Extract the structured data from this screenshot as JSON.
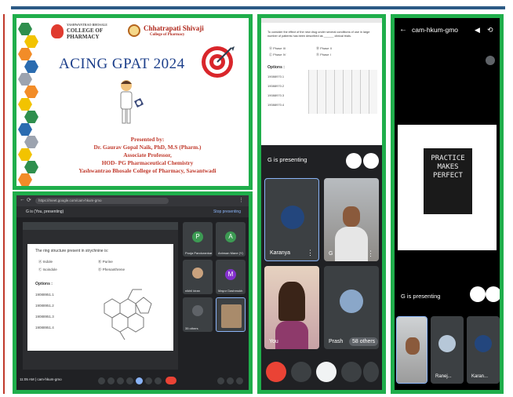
{
  "slide_title": {
    "college_name_small": "YASHWANTRAO BHOSALE",
    "college_name": "COLLEGE OF",
    "college_name2": "PHARMACY",
    "partner_name": "Chhatrapati Shivaji",
    "partner_sub": "College of Pharmacy",
    "title": "ACING GPAT 2024",
    "presented_by": "Presented by:",
    "presenter": "Dr. Gaurav Gopal Naik, PhD, M.S (Pharm.)",
    "role1": "Associate Professor,",
    "role2": "HOD- PG Pharmaceutical Chemistry",
    "institution": "Yashwantrao Bhosale College of Pharmacy, Sawantwadi"
  },
  "share_screen": {
    "url": "https://meet.google.com/cam-hkum-gmo",
    "presenting_label": "G is (You, presenting)",
    "stop_label": "Stop presenting",
    "question": "The ring structure present in strychnine is:",
    "options": [
      "Indole",
      "Purine",
      "Isoindole",
      "Phenanthrene"
    ],
    "options_heading": "Options :",
    "option_codes": [
      "19088951.1",
      "19088951.2",
      "19088951.3",
      "19088951.4"
    ],
    "tiles": [
      {
        "initial": "P",
        "name": "Pooja Pandurankar",
        "color": "#3c9a53"
      },
      {
        "initial": "A",
        "name": "Anirwan Mane (Y)",
        "color": "#3c9a53"
      },
      {
        "initial": "",
        "name": "nikhil kiran",
        "color": "#3c4043"
      },
      {
        "initial": "M",
        "name": "Mayur Dashmukh",
        "color": "#8430ce"
      },
      {
        "initial": "",
        "name": "35 others",
        "color": "#3c4043"
      },
      {
        "initial": "",
        "name": "",
        "color": "#3c4043"
      }
    ],
    "time_meeting": "11:05 AM  |  cam-hkum-gmo"
  },
  "phone1": {
    "question_text": "To consider the effect of the new drug under several conditions of use in large number of patients has been described as ______ clinical trials.",
    "options": [
      "Phase III",
      "Phase II",
      "Phase IV",
      "Phase I"
    ],
    "options_heading": "Options :",
    "option_codes": [
      "19088970.1",
      "19088970.2",
      "19088970.3",
      "19088970.4"
    ],
    "presenting": "G is presenting",
    "tiles": [
      {
        "name": "Karanya"
      },
      {
        "name": "G"
      },
      {
        "name": "You"
      },
      {
        "name": "Prash"
      }
    ],
    "others": "58 others"
  },
  "phone2": {
    "meeting_code": "cam-hkum-gmo",
    "slide_text_1": "PRACTICE",
    "slide_text_2": "MAKES",
    "slide_text_3": "PERFECT",
    "presenting": "G is presenting",
    "tiles": [
      {
        "name": ""
      },
      {
        "name": "Ranej..."
      },
      {
        "name": "Karan..."
      }
    ]
  },
  "colors": {
    "frame_green": "#1fae4b",
    "meet_dark": "#202124",
    "end_call_red": "#ea4335",
    "title_blue": "#1b3e8a",
    "presenter_red": "#c0392b"
  }
}
